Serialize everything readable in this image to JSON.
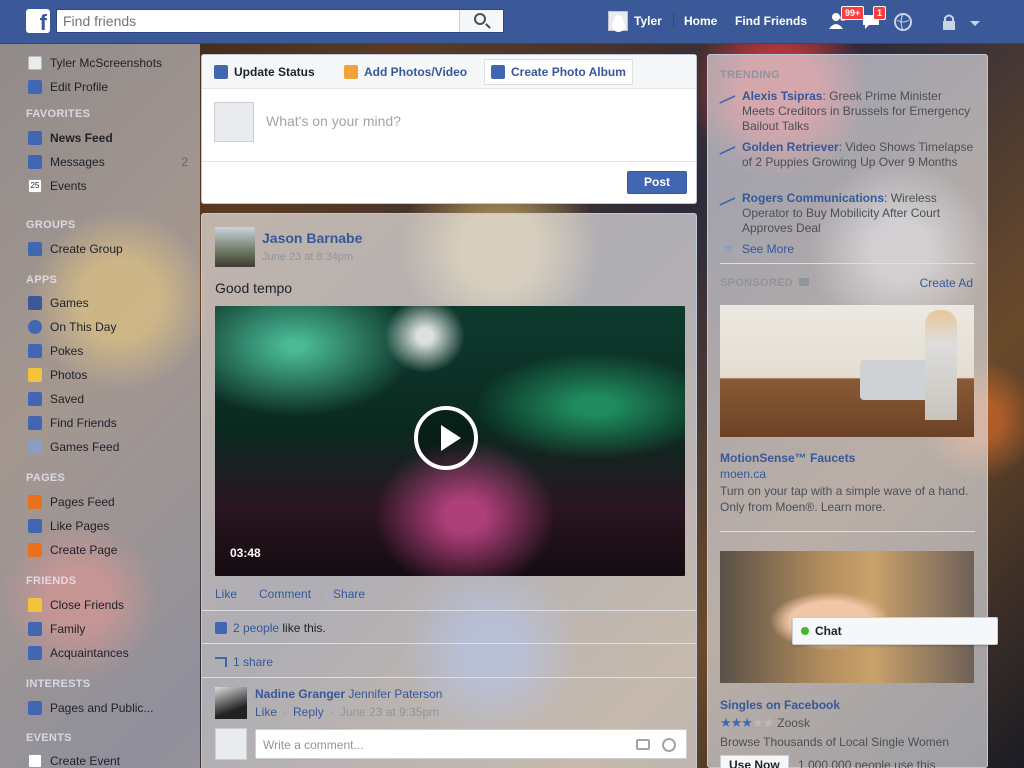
{
  "topbar": {
    "search_placeholder": "Find friends",
    "user_name": "Tyler",
    "home_label": "Home",
    "find_friends_label": "Find Friends",
    "friend_requests_badge": "99+",
    "messages_badge": "1"
  },
  "leftnav": {
    "profile_name": "Tyler McScreenshots",
    "edit_profile": "Edit Profile",
    "favorites_header": "FAVORITES",
    "favorites": [
      {
        "label": "News Feed",
        "count": ""
      },
      {
        "label": "Messages",
        "count": "2"
      },
      {
        "label": "Events",
        "count": ""
      }
    ],
    "groups_header": "GROUPS",
    "create_group": "Create Group",
    "apps_header": "APPS",
    "apps": [
      "Games",
      "On This Day",
      "Pokes",
      "Photos",
      "Saved",
      "Find Friends",
      "Games Feed"
    ],
    "pages_header": "PAGES",
    "pages": [
      "Pages Feed",
      "Like Pages",
      "Create Page"
    ],
    "friends_header": "FRIENDS",
    "friends": [
      "Close Friends",
      "Family",
      "Acquaintances"
    ],
    "interests_header": "INTERESTS",
    "interests": [
      "Pages and Public..."
    ],
    "events_header": "EVENTS",
    "events": [
      "Create Event"
    ]
  },
  "composer": {
    "tab_status": "Update Status",
    "tab_photos": "Add Photos/Video",
    "tab_album": "Create Photo Album",
    "placeholder": "What's on your mind?",
    "post_label": "Post"
  },
  "post": {
    "author": "Jason Barnabe",
    "timestamp": "June 23 at 8:34pm",
    "text": "Good tempo",
    "video_duration": "03:48",
    "like_label": "Like",
    "comment_label": "Comment",
    "share_label": "Share",
    "likes_link": "2 people",
    "likes_suffix": "like this.",
    "shares": "1 share",
    "comment": {
      "author": "Nadine Granger",
      "tagged": "Jennifer Paterson",
      "like": "Like",
      "reply": "Reply",
      "time": "June 23 at 9:35pm"
    },
    "write_comment_placeholder": "Write a comment..."
  },
  "rightcol": {
    "trending_header": "TRENDING",
    "trending": [
      {
        "topic": "Alexis Tsipras",
        "desc": ": Greek Prime Minister Meets Creditors in Brussels for Emergency Bailout Talks"
      },
      {
        "topic": "Golden Retriever",
        "desc": ": Video Shows Timelapse of 2 Puppies Growing Up Over 9 Months"
      },
      {
        "topic": "Rogers Communications",
        "desc": ": Wireless Operator to Buy Mobilicity After Court Approves Deal"
      }
    ],
    "see_more": "See More",
    "sponsored_header": "SPONSORED",
    "create_ad": "Create Ad",
    "ads": [
      {
        "title": "MotionSense™ Faucets",
        "domain": "moen.ca",
        "body": "Turn on your tap with a simple wave of a hand. Only from Moen®. Learn more."
      },
      {
        "title": "Singles on Facebook",
        "domain": "Zoosk",
        "body": "Browse Thousands of Local Single Women",
        "cta": "Use Now",
        "social": "1,000,000 people use this"
      }
    ],
    "ad2_rating_stars": 3
  },
  "chat": {
    "label": "Chat"
  }
}
